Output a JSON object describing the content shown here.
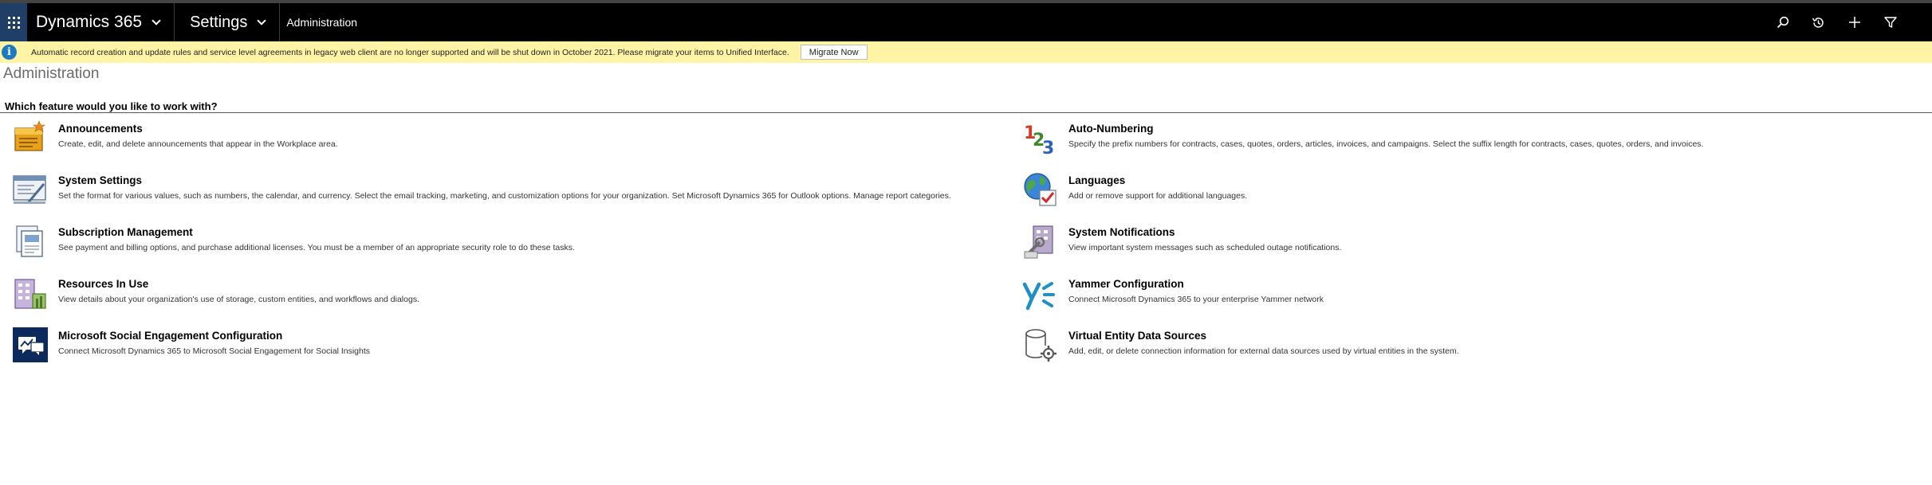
{
  "nav": {
    "brand": "Dynamics 365",
    "area": "Settings",
    "breadcrumb": "Administration"
  },
  "banner": {
    "message": "Automatic record creation and update rules and service level agreements in legacy web client are no longer supported and will be shut down in October 2021. Please migrate your items to Unified Interface.",
    "button": "Migrate Now"
  },
  "page": {
    "title": "Administration",
    "question": "Which feature would you like to work with?"
  },
  "features": {
    "announcements": {
      "name": "Announcements",
      "desc": "Create, edit, and delete announcements that appear in the Workplace area."
    },
    "system_settings": {
      "name": "System Settings",
      "desc": "Set the format for various values, such as numbers, the calendar, and currency. Select the email tracking, marketing, and customization options for your organization. Set Microsoft Dynamics 365 for Outlook options. Manage report categories."
    },
    "subscription": {
      "name": "Subscription Management",
      "desc": "See payment and billing options, and purchase additional licenses. You must be a member of an appropriate security role to do these tasks."
    },
    "resources": {
      "name": "Resources In Use",
      "desc": "View details about your organization's use of storage, custom entities, and workflows and dialogs."
    },
    "social": {
      "name": "Microsoft Social Engagement Configuration",
      "desc": "Connect Microsoft Dynamics 365 to Microsoft Social Engagement for Social Insights"
    },
    "auto_numbering": {
      "name": "Auto-Numbering",
      "desc": "Specify the prefix numbers for contracts, cases, quotes, orders, articles, invoices, and campaigns. Select the suffix length for contracts, cases, quotes, orders, and invoices."
    },
    "languages": {
      "name": "Languages",
      "desc": "Add or remove support for additional languages."
    },
    "notifications": {
      "name": "System Notifications",
      "desc": "View important system messages such as scheduled outage notifications."
    },
    "yammer": {
      "name": "Yammer Configuration",
      "desc": "Connect Microsoft Dynamics 365 to your enterprise Yammer network"
    },
    "virtual_entity": {
      "name": "Virtual Entity Data Sources",
      "desc": "Add, edit, or delete connection information for external data sources used by virtual entities in the system."
    }
  },
  "icons": {
    "waffle": "app-launcher-icon",
    "search": "search-icon",
    "recent": "recent-history-icon",
    "new": "plus-icon",
    "filter": "filter-icon",
    "info": "info-icon"
  },
  "colors": {
    "topbar": "#000000",
    "waffle_bg": "#1f3f66",
    "banner_bg": "#fff3a6",
    "info_blue": "#1e7ac0"
  }
}
